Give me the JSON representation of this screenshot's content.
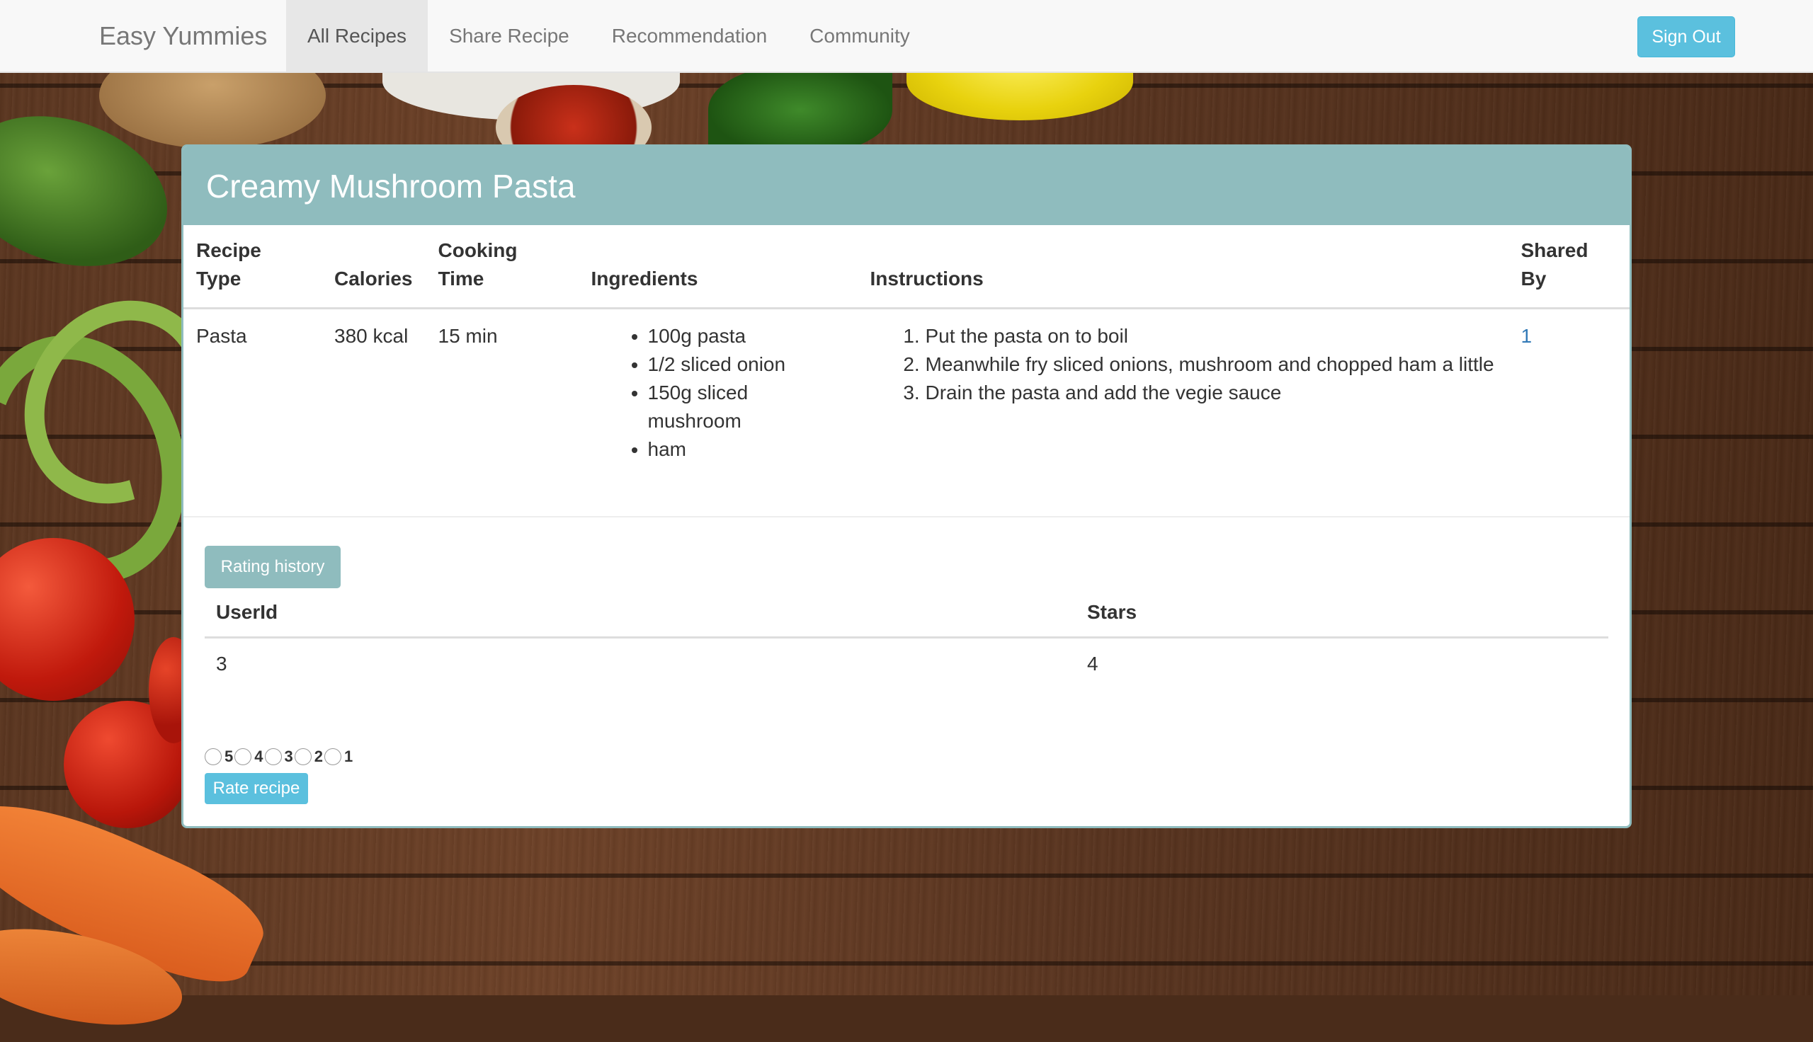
{
  "navbar": {
    "brand": "Easy Yummies",
    "items": [
      {
        "label": "All Recipes",
        "active": true
      },
      {
        "label": "Share Recipe",
        "active": false
      },
      {
        "label": "Recommendation",
        "active": false
      },
      {
        "label": "Community",
        "active": false
      }
    ],
    "sign_out": "Sign Out"
  },
  "recipe": {
    "title": "Creamy Mushroom Pasta",
    "headers": {
      "recipe_type": "Recipe Type",
      "calories": "Calories",
      "cooking_time": "Cooking Time",
      "ingredients": "Ingredients",
      "instructions": "Instructions",
      "shared_by": "Shared By"
    },
    "recipe_type": "Pasta",
    "calories": "380 kcal",
    "cooking_time": "15 min",
    "ingredients": [
      "100g pasta",
      "1/2 sliced onion",
      "150g sliced mushroom",
      "ham"
    ],
    "instructions": [
      "Put the pasta on to boil",
      "Meanwhile fry sliced onions, mushroom and chopped ham a little",
      "Drain the pasta and add the vegie sauce"
    ],
    "shared_by": "1"
  },
  "rating": {
    "history_button": "Rating history",
    "headers": {
      "user_id": "UserId",
      "stars": "Stars"
    },
    "rows": [
      {
        "user_id": "3",
        "stars": "4"
      }
    ],
    "options": [
      "5",
      "4",
      "3",
      "2",
      "1"
    ],
    "rate_button": "Rate recipe"
  },
  "colors": {
    "panel_accent": "#8fbcbe",
    "info_button": "#5bc0de",
    "link": "#337ab7"
  }
}
